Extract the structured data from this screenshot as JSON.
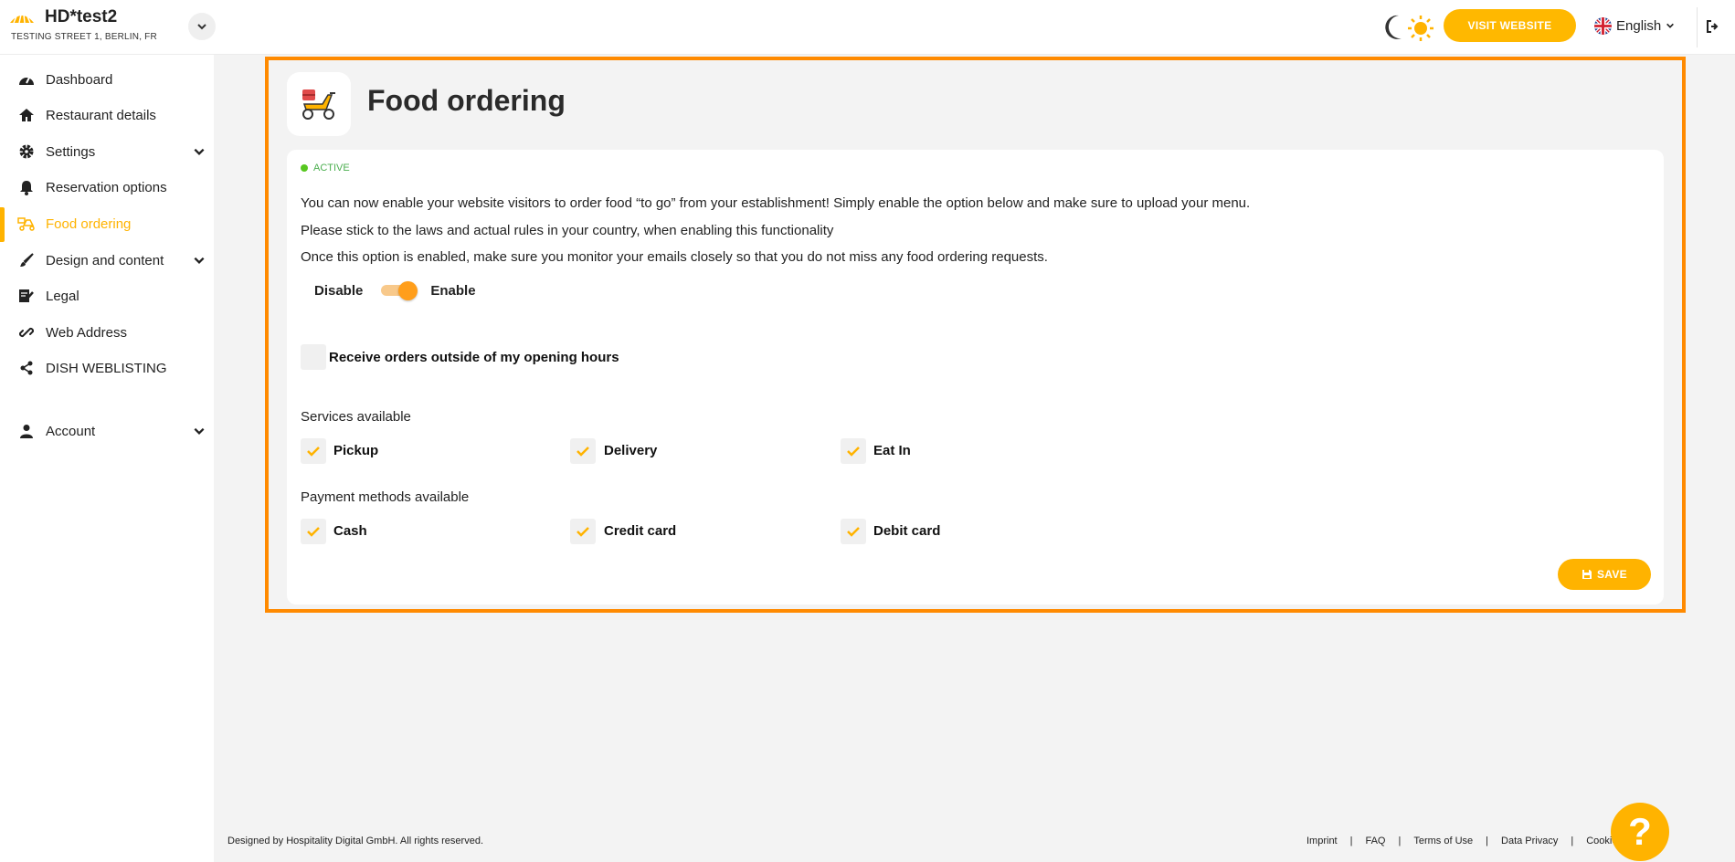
{
  "header": {
    "brand": "HD*test2",
    "address": "TESTING STREET 1, BERLIN, FR",
    "visit_website": "VISIT WEBSITE",
    "language": "English"
  },
  "sidebar": {
    "items": [
      {
        "label": "Dashboard",
        "icon": "dashboard-icon"
      },
      {
        "label": "Restaurant details",
        "icon": "home-icon"
      },
      {
        "label": "Settings",
        "icon": "gear-icon"
      },
      {
        "label": "Reservation options",
        "icon": "bell-icon"
      },
      {
        "label": "Food ordering",
        "icon": "food-ordering-icon"
      },
      {
        "label": "Design and content",
        "icon": "brush-icon"
      },
      {
        "label": "Legal",
        "icon": "legal-icon"
      },
      {
        "label": "Web Address",
        "icon": "link-icon"
      },
      {
        "label": "DISH WEBLISTING",
        "icon": "share-icon"
      },
      {
        "label": "Account",
        "icon": "user-icon"
      }
    ],
    "active": "Food ordering"
  },
  "main": {
    "title": "Food ordering",
    "status": "ACTIVE",
    "paragraphs": [
      "You can now enable your website visitors to order food “to go” from your establishment! Simply enable the option below and make sure to upload your menu.",
      "Please stick to the laws and actual rules in your country, when enabling this functionality",
      "Once this option is enabled, make sure you monitor your emails closely so that you do not miss any food ordering requests."
    ],
    "toggle": {
      "off_label": "Disable",
      "on_label": "Enable",
      "enabled": true
    },
    "outside_hours_label": "Receive orders outside of my opening hours",
    "services_label": "Services available",
    "services": [
      "Pickup",
      "Delivery",
      "Eat In"
    ],
    "payments_label": "Payment methods available",
    "payments": [
      "Cash",
      "Credit card",
      "Debit card"
    ],
    "save_label": "SAVE"
  },
  "footer": {
    "copyright": "Designed by Hospitality Digital GmbH. All rights reserved.",
    "links": [
      "Imprint",
      "FAQ",
      "Terms of Use",
      "Data Privacy",
      "Cookie settings"
    ]
  },
  "colors": {
    "accent": "#ffb300",
    "highlight": "#ff8a00",
    "active": "#57c71f"
  }
}
